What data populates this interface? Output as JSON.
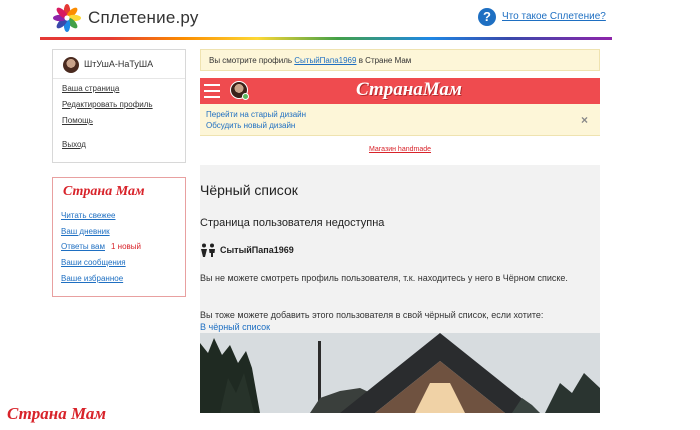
{
  "header": {
    "site_name": "Сплетение.ру",
    "help_link": "Что такое Сплетение?"
  },
  "user_panel": {
    "username": "ШтУшА-НаТуША",
    "links": [
      "Ваша страница",
      "Редактировать профиль",
      "Помощь"
    ],
    "logout": "Выход"
  },
  "mam_panel": {
    "title": "Страна Мам",
    "links": [
      "Читать свежее",
      "Ваш дневник",
      "Ответы вам",
      "Ваши сообщения",
      "Ваше избранное"
    ],
    "new_badge": "1 новый"
  },
  "bottom_logo": "Страна Мам",
  "notice": {
    "prefix": "Вы смотрите профиль",
    "profile": "СытыйПапа1969",
    "suffix": "в Стране Мам"
  },
  "redbar": {
    "logo": "СтранаМам"
  },
  "design_links": [
    "Перейти на старый дизайн",
    "Обсудить новый дизайн"
  ],
  "close_icon": "×",
  "shop_link": "Магазин handmade",
  "content": {
    "title": "Чёрный список",
    "subtitle": "Страница пользователя недоступна",
    "profile_name": "СытыйПапа1969",
    "text1": "Вы не можете смотреть профиль пользователя, т.к. находитесь у него в Чёрном списке.",
    "text2": "Вы тоже можете добавить этого пользователя в свой чёрный список, если хотите:",
    "blacklist_link": "В чёрный список"
  },
  "icons": {
    "logo": "flower-logo-icon",
    "help": "question-icon",
    "menu": "hamburger-icon",
    "profile": "couple-icon"
  },
  "colors": {
    "brand_red": "#ef4b4f",
    "link_blue": "#1e6fc2",
    "notice_bg": "#fdf6d8"
  }
}
